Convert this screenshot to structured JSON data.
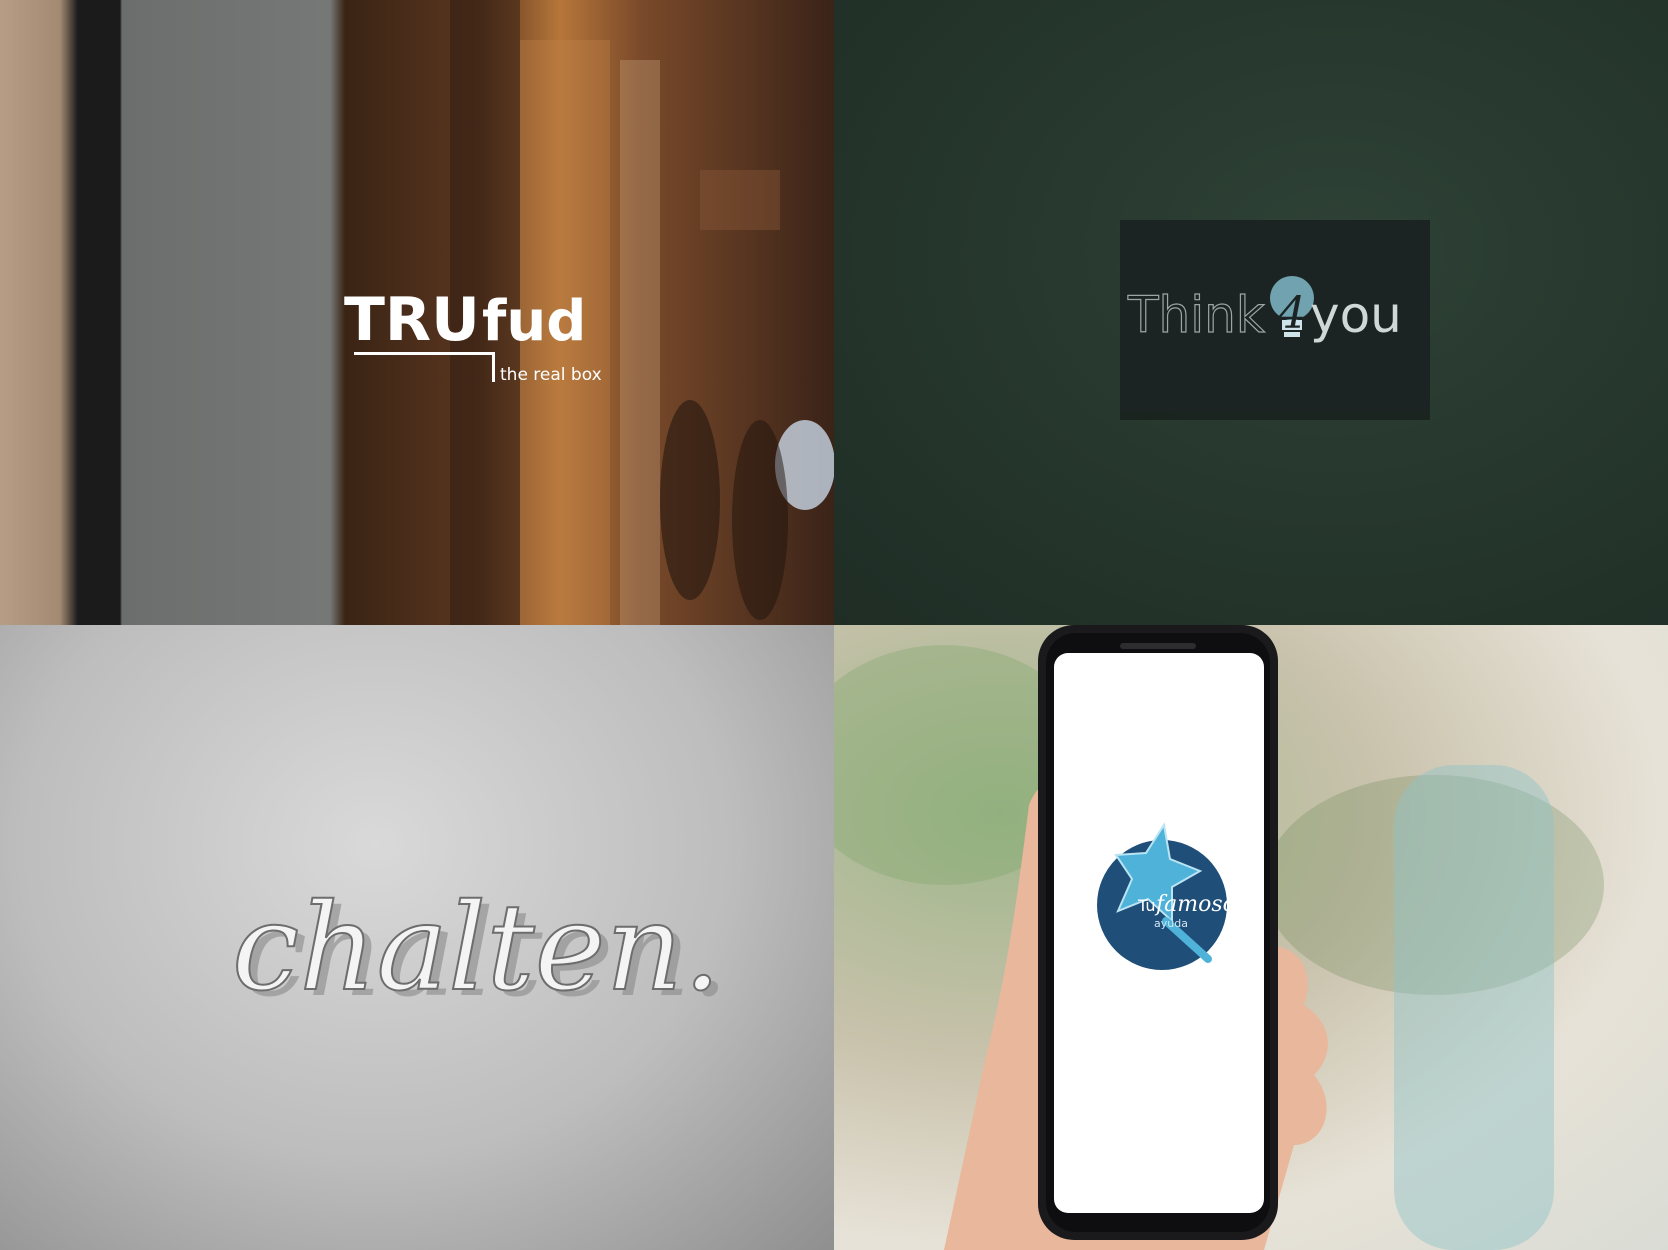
{
  "panels": {
    "trufud": {
      "brand_main": "TRU",
      "brand_accent": "fud",
      "tagline": "the real box"
    },
    "think4you": {
      "word_left": "Think",
      "numeral": "4",
      "word_right": "you",
      "icon": "lightbulb-icon"
    },
    "chalten": {
      "wordmark": "chalten."
    },
    "tufamoso": {
      "prefix": "Tu",
      "name": "famoso",
      "subline": "ayuda",
      "icon": "star-icon"
    }
  },
  "colors": {
    "think_teal": "#7fb8c8",
    "tufamoso_blue": "#1f4e78",
    "tufamoso_star": "#4fb3d9"
  }
}
